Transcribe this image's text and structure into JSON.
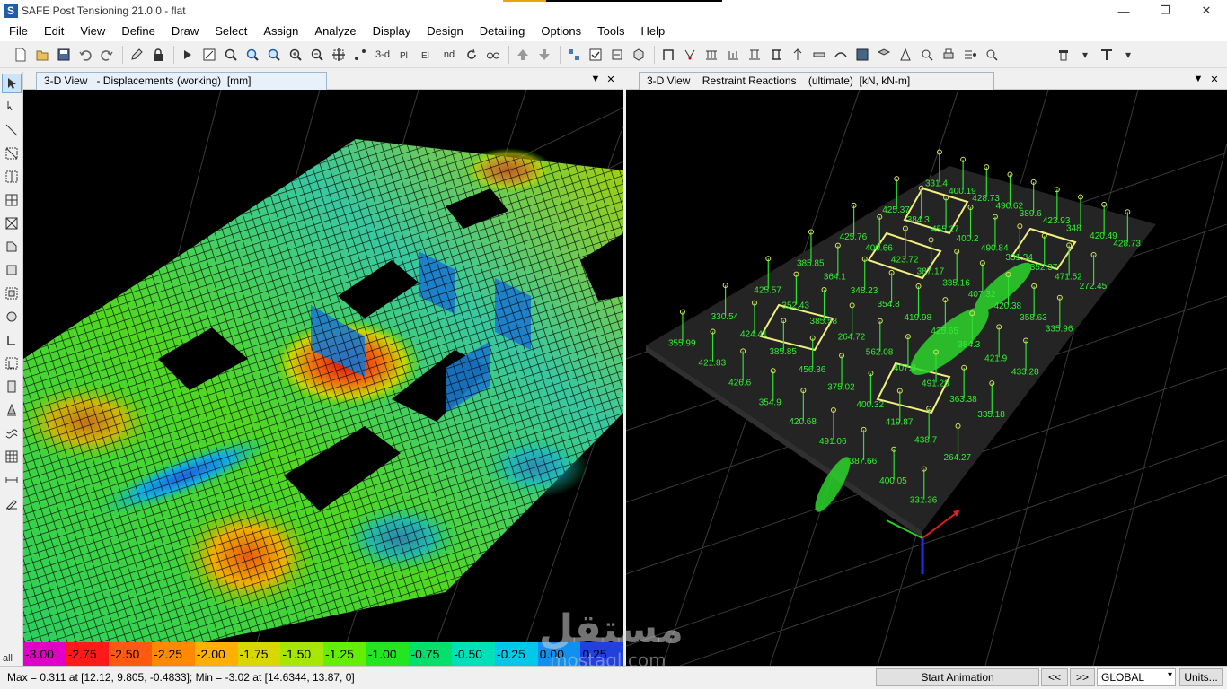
{
  "window": {
    "title": "SAFE Post Tensioning 21.0.0 - flat",
    "app_icon_letter": "S",
    "minimize": "—",
    "maximize": "❐",
    "close": "✕"
  },
  "menu": [
    "File",
    "Edit",
    "View",
    "Define",
    "Draw",
    "Select",
    "Assign",
    "Analyze",
    "Display",
    "Design",
    "Detailing",
    "Options",
    "Tools",
    "Help"
  ],
  "toolbar": {
    "btn_3d": "3-d",
    "btn_nd": "nd"
  },
  "left_tools": {
    "all_label": "all"
  },
  "left_view": {
    "tab_title": "3-D View   - Displacements (working)  [mm]",
    "dropdown_icon": "▼",
    "close_icon": "✕",
    "legend": {
      "labels": [
        "-3.00",
        "-2.75",
        "-2.50",
        "-2.25",
        "-2.00",
        "-1.75",
        "-1.50",
        "-1.25",
        "-1.00",
        "-0.75",
        "-0.50",
        "-0.25",
        "0.00",
        "0.25"
      ],
      "colors": [
        "#e000c8",
        "#ff1a1a",
        "#ff5a10",
        "#ff8a00",
        "#ffb000",
        "#d8d800",
        "#a6e600",
        "#66ee00",
        "#22e622",
        "#00e06a",
        "#00e0b8",
        "#00c8e8",
        "#1090f0",
        "#2040e0"
      ]
    }
  },
  "right_view": {
    "tab_title": "3-D View    Restraint Reactions    (ultimate)  [kN, kN-m]",
    "dropdown_icon": "▼",
    "close_icon": "✕",
    "reaction_labels": [
      "331.4",
      "400.19",
      "428.73",
      "490.62",
      "389.6",
      "423.93",
      "348",
      "420.49",
      "428.73",
      "425.37",
      "384.3",
      "455.27",
      "400.2",
      "490.84",
      "331.34",
      "352.37",
      "471.52",
      "272.45",
      "425.76",
      "400.66",
      "423.72",
      "387.17",
      "335.16",
      "407.32",
      "420.38",
      "358.63",
      "335.96",
      "385.85",
      "364.1",
      "348.23",
      "354.8",
      "419.98",
      "425.65",
      "384.3",
      "421.9",
      "433.28",
      "425.57",
      "352.43",
      "385.58",
      "264.72",
      "562.08",
      "407.3",
      "491.28",
      "363.38",
      "335.18",
      "330.54",
      "424.41",
      "385.85",
      "456.36",
      "375.02",
      "400.32",
      "419.87",
      "438.7",
      "264.27",
      "355.99",
      "421.83",
      "426.6",
      "354.9",
      "420.68",
      "491.06",
      "387.66",
      "400.05",
      "331.36"
    ]
  },
  "watermark": {
    "line1": "مستقل",
    "line2": "mostaql.com"
  },
  "status": {
    "text": "Max = 0.311 at [12.12, 9.805, -0.4833];  Min = -3.02 at [14.6344, 13.87, 0]",
    "start_animation": "Start Animation",
    "prev": "<<",
    "next": ">>",
    "coord_system": "GLOBAL",
    "units": "Units..."
  }
}
